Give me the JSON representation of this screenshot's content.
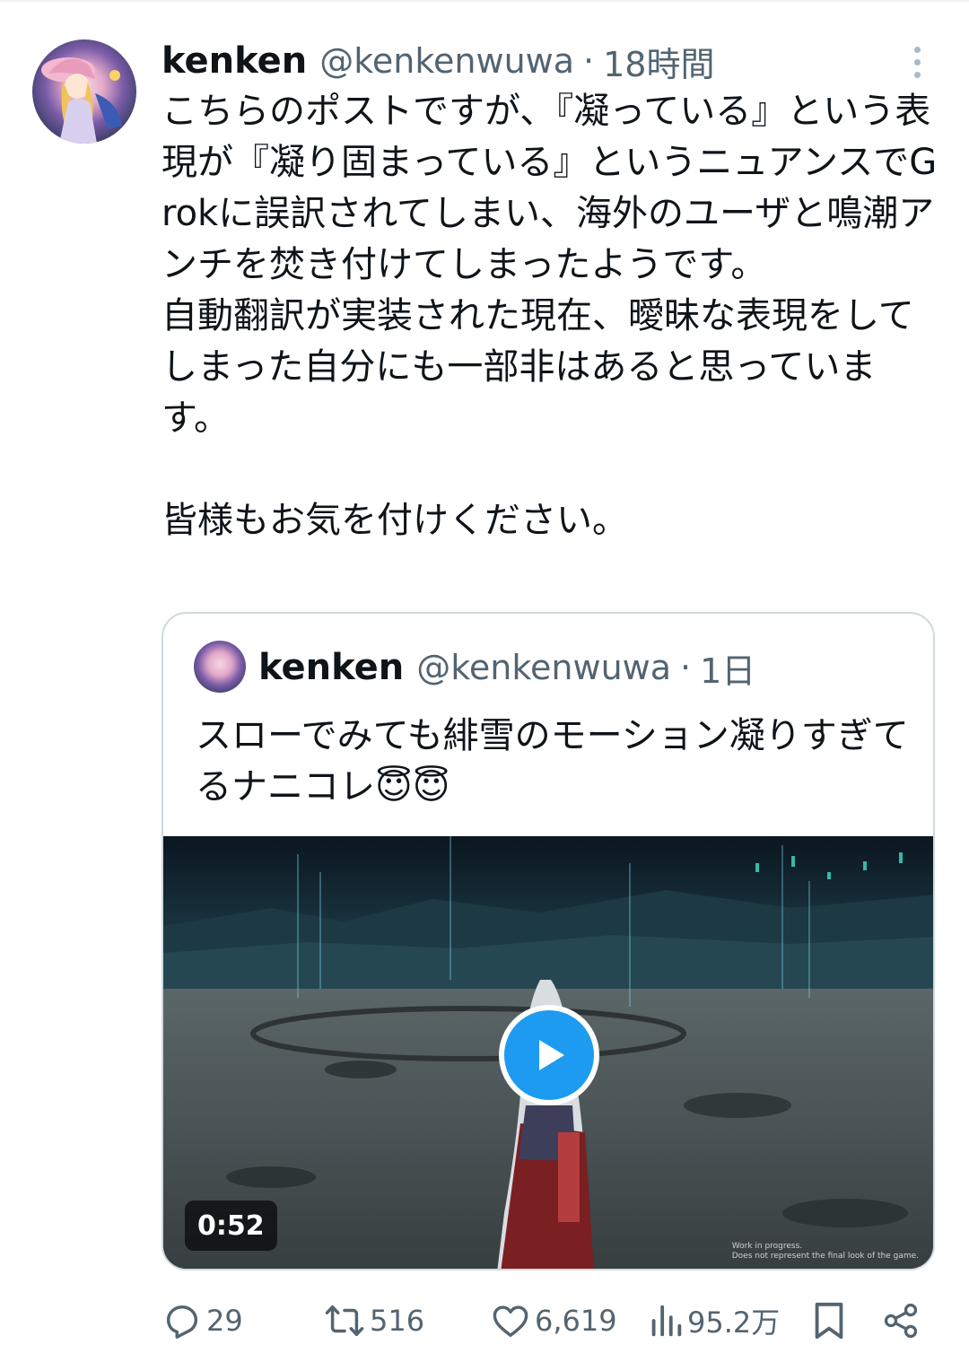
{
  "tweet": {
    "author": {
      "display_name": "kenken",
      "handle": "@kenkenwuwa",
      "separator": "·",
      "time": "18時間"
    },
    "text": "こちらのポストですが、『凝っている』という表現が『凝り固まっている』というニュアンスでGrokに誤訳されてしまい、海外のユーザと鳴潮アンチを焚き付けてしまったようです。\n自動翻訳が実装された現在、曖昧な表現をしてしまった自分にも一部非はあると思っています。\n\n皆様もお気を付けください。"
  },
  "quote": {
    "author": {
      "display_name": "kenken",
      "handle": "@kenkenwuwa",
      "separator": "·",
      "time": "1日"
    },
    "text": "スローでみても緋雪のモーション凝りすぎてるナニコレ😇😇",
    "video": {
      "duration": "0:52",
      "watermark_line1": "Work in progress.",
      "watermark_line2": "Does not represent the final look of the game."
    }
  },
  "actions": {
    "replies": "29",
    "reposts": "516",
    "likes": "6,619",
    "views": "95.2万"
  },
  "icons": {
    "more": "more-vertical-icon",
    "reply": "reply-icon",
    "repost": "repost-icon",
    "like": "heart-icon",
    "views": "views-icon",
    "bookmark": "bookmark-icon",
    "share": "share-icon",
    "play": "play-icon"
  },
  "colors": {
    "accent": "#1d9bf0",
    "secondary_text": "#536471",
    "primary_text": "#0f1419",
    "border": "#cfd9de"
  }
}
